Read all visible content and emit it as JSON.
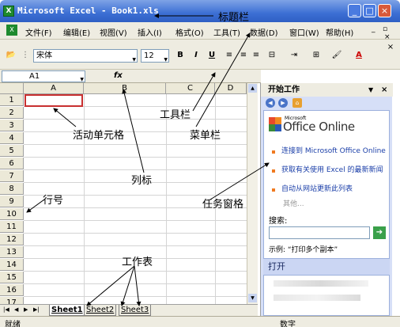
{
  "window": {
    "title": "Microsoft Excel - Book1.xls",
    "icon": "excel-icon"
  },
  "window_controls": [
    "_",
    "□",
    "×"
  ],
  "menu": [
    "文件(F)",
    "编辑(E)",
    "视图(V)",
    "插入(I)",
    "格式(O)",
    "工具(T)",
    "数据(D)",
    "窗口(W)",
    "帮助(H)"
  ],
  "toolbar": {
    "font": "宋体",
    "size": "12",
    "bold": "B",
    "italic": "I",
    "underline": "U"
  },
  "formula": {
    "cell_ref": "A1",
    "fx": "fx"
  },
  "grid": {
    "columns": [
      "A",
      "B",
      "C",
      "D"
    ],
    "rows": [
      "1",
      "2",
      "3",
      "4",
      "5",
      "6",
      "7",
      "8",
      "9",
      "10",
      "11",
      "12",
      "13",
      "14",
      "15",
      "16",
      "17"
    ],
    "active_cell": "A1"
  },
  "sheets": [
    "Sheet1",
    "Sheet2",
    "Sheet3"
  ],
  "status": {
    "ready": "就绪",
    "num": "数字"
  },
  "task_pane": {
    "title": "开始工作",
    "logo_small": "Microsoft",
    "logo": "Office Online",
    "links": [
      "连接到 Microsoft Office Online",
      "获取有关使用 Excel 的最新新闻",
      "自动从网站更新此列表"
    ],
    "more": "其他...",
    "search_label": "搜索:",
    "example": "示例: “打印多个副本”",
    "open_section": "打开"
  },
  "annotations": {
    "title_bar": "标题栏",
    "toolbar": "工具栏",
    "menu_bar": "菜单栏",
    "active_cell": "活动单元格",
    "column_label": "列标",
    "row_number": "行号",
    "task_pane": "任务窗格",
    "sheets": "工作表"
  }
}
